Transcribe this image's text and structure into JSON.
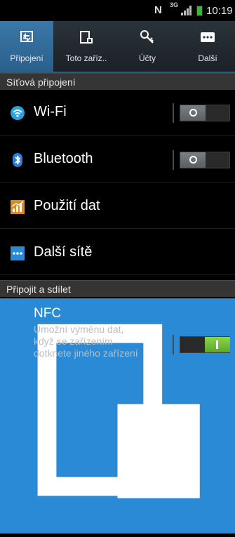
{
  "status_bar": {
    "n_indicator": "N",
    "network_type": "3G",
    "time": "10:19"
  },
  "tabs": [
    {
      "label": "Připojení",
      "icon": "connections-icon",
      "selected": true
    },
    {
      "label": "Toto zaříz..",
      "icon": "device-icon",
      "selected": false
    },
    {
      "label": "Účty",
      "icon": "accounts-key-icon",
      "selected": false
    },
    {
      "label": "Další",
      "icon": "more-icon",
      "selected": false
    }
  ],
  "sections": {
    "network": {
      "header": "Síťová připojení",
      "items": {
        "wifi": {
          "label": "Wi-Fi",
          "icon": "wifi-icon",
          "toggle": "off"
        },
        "bluetooth": {
          "label": "Bluetooth",
          "icon": "bluetooth-icon",
          "toggle": "off"
        },
        "data_usage": {
          "label": "Použití dat",
          "icon": "data-usage-icon"
        },
        "more_networks": {
          "label": "Další sítě",
          "icon": "more-networks-icon"
        }
      }
    },
    "connect_share": {
      "header": "Připojit a sdílet",
      "nfc": {
        "title": "NFC",
        "description": "Umožní výměnu dat, když se zařízením dotknete jiného zařízení",
        "icon": "nfc-icon",
        "toggle": "on"
      }
    }
  },
  "colors": {
    "accent_tab": "#2a5f8c",
    "toggle_on": "#6cbf34",
    "toggle_off": "#6a6f74",
    "section_header": "#353535"
  }
}
